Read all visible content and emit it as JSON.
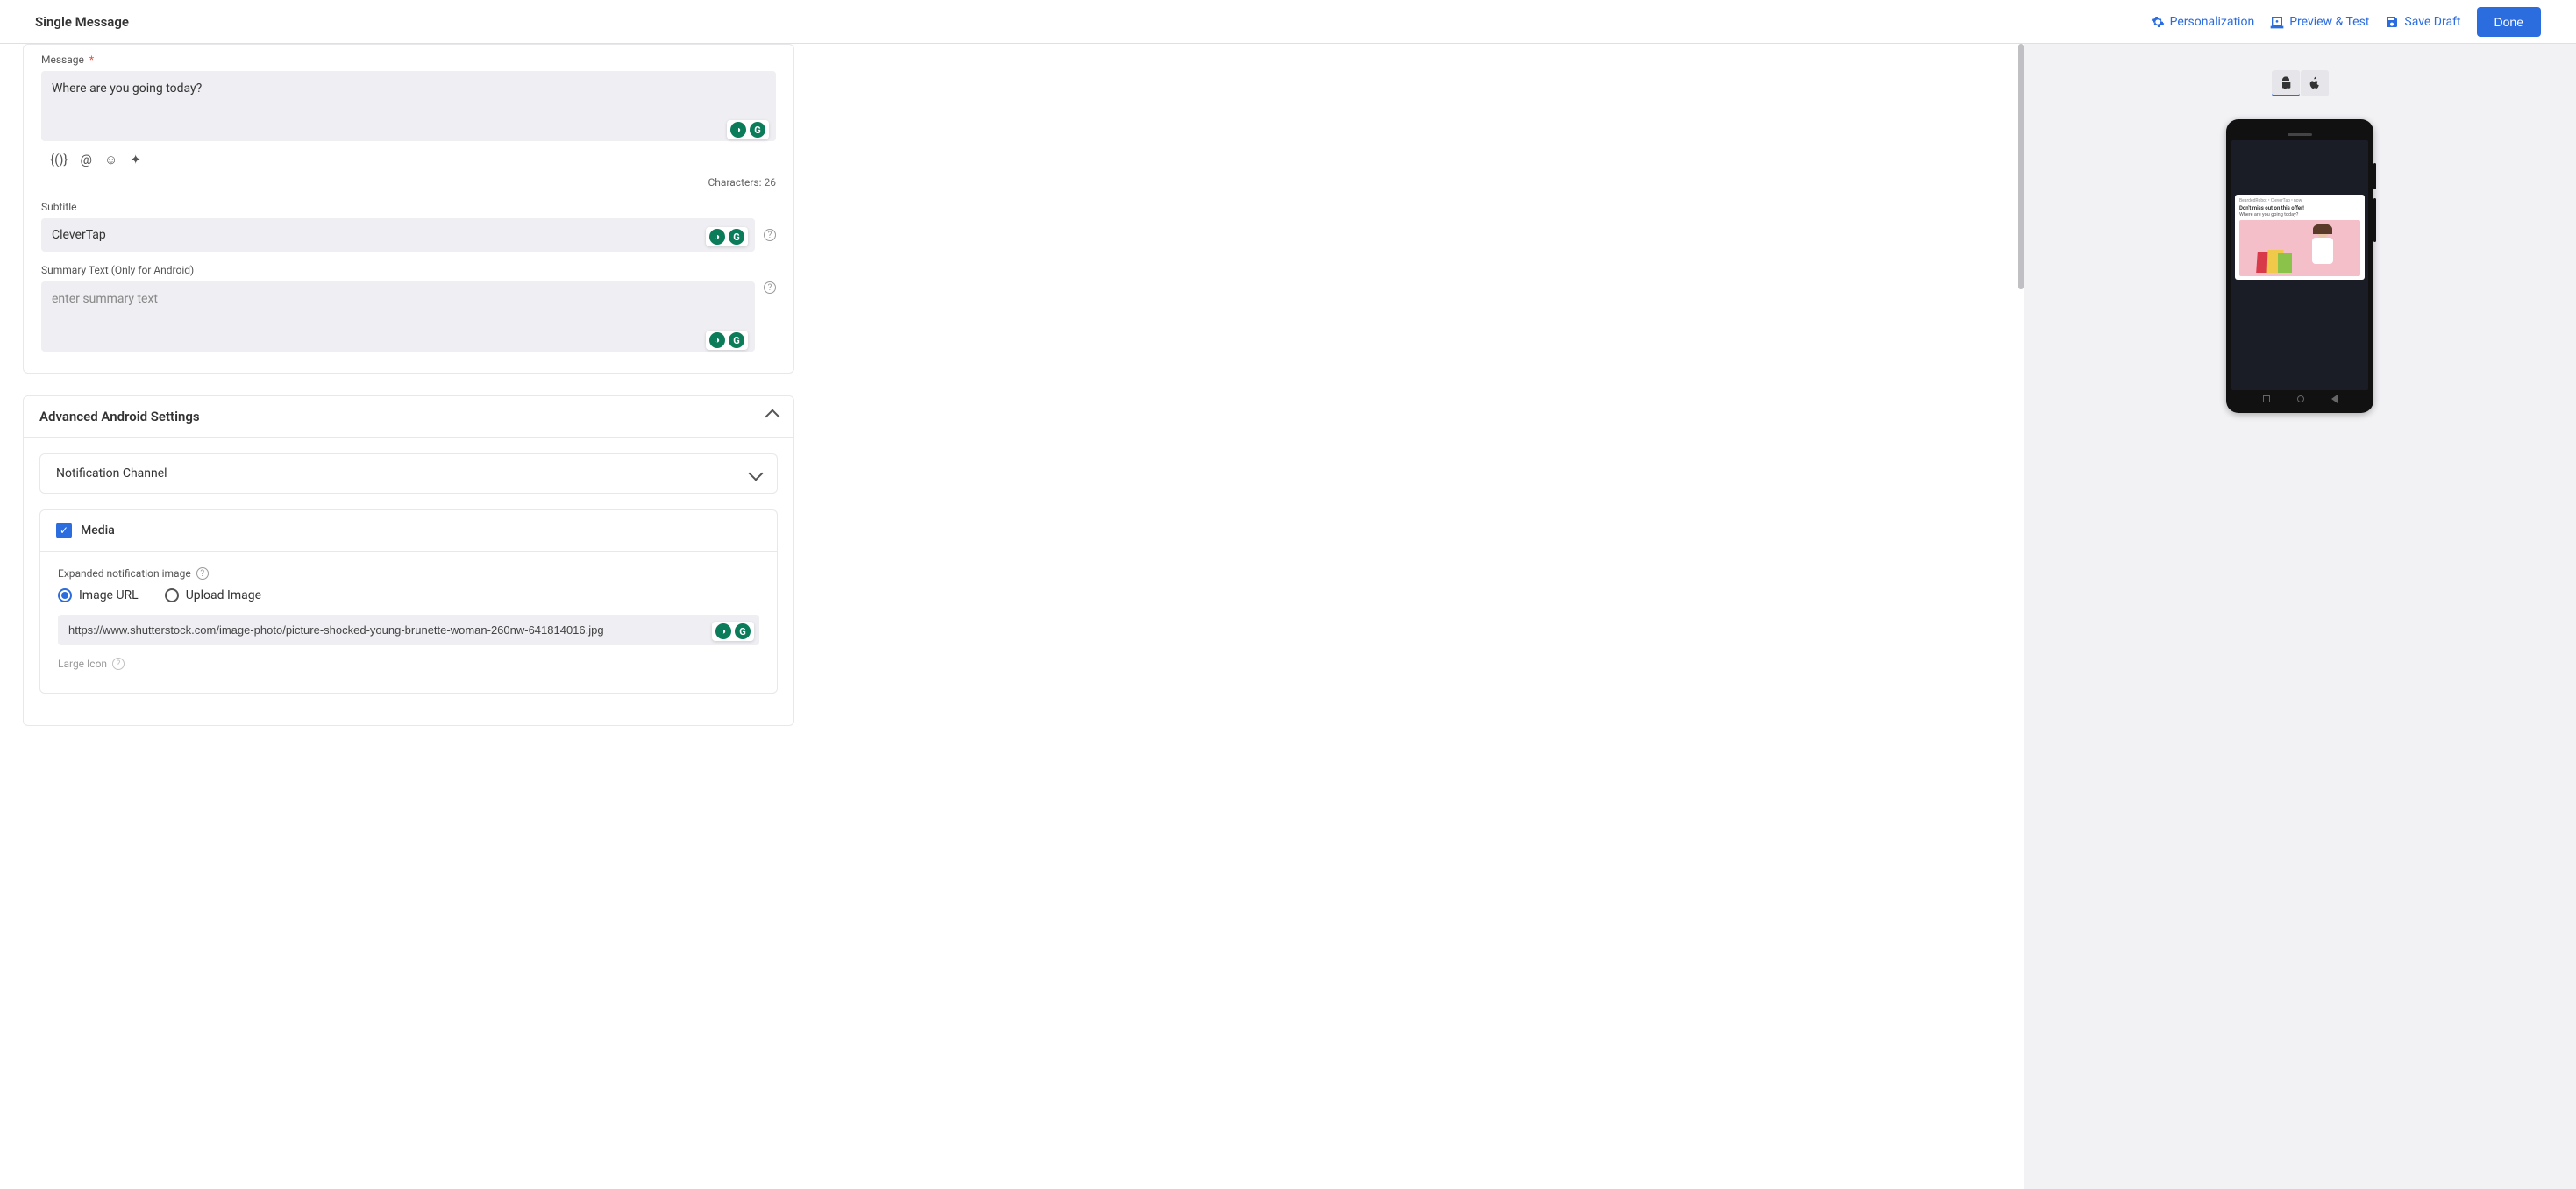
{
  "header": {
    "title": "Single Message",
    "personalization": "Personalization",
    "preview_test": "Preview & Test",
    "save_draft": "Save Draft",
    "done": "Done"
  },
  "message": {
    "label": "Message",
    "value": "Where are you going today?",
    "char_count": "Characters: 26"
  },
  "subtitle": {
    "label": "Subtitle",
    "value": "CleverTap"
  },
  "summary": {
    "label": "Summary Text (Only for Android)",
    "placeholder": "enter summary text",
    "value": ""
  },
  "advanced": {
    "title": "Advanced Android Settings",
    "notification_channel": "Notification Channel",
    "media": {
      "title": "Media",
      "expanded_label": "Expanded notification image",
      "opt_url": "Image URL",
      "opt_upload": "Upload Image",
      "url_value": "https://www.shutterstock.com/image-photo/picture-shocked-young-brunette-woman-260nw-641814016.jpg",
      "large_icon": "Large Icon"
    }
  },
  "preview": {
    "app_meta": "BeardedRobot  • CleverTap  • now",
    "title": "Don't miss out on this offer!",
    "body": "Where are you going today?"
  }
}
